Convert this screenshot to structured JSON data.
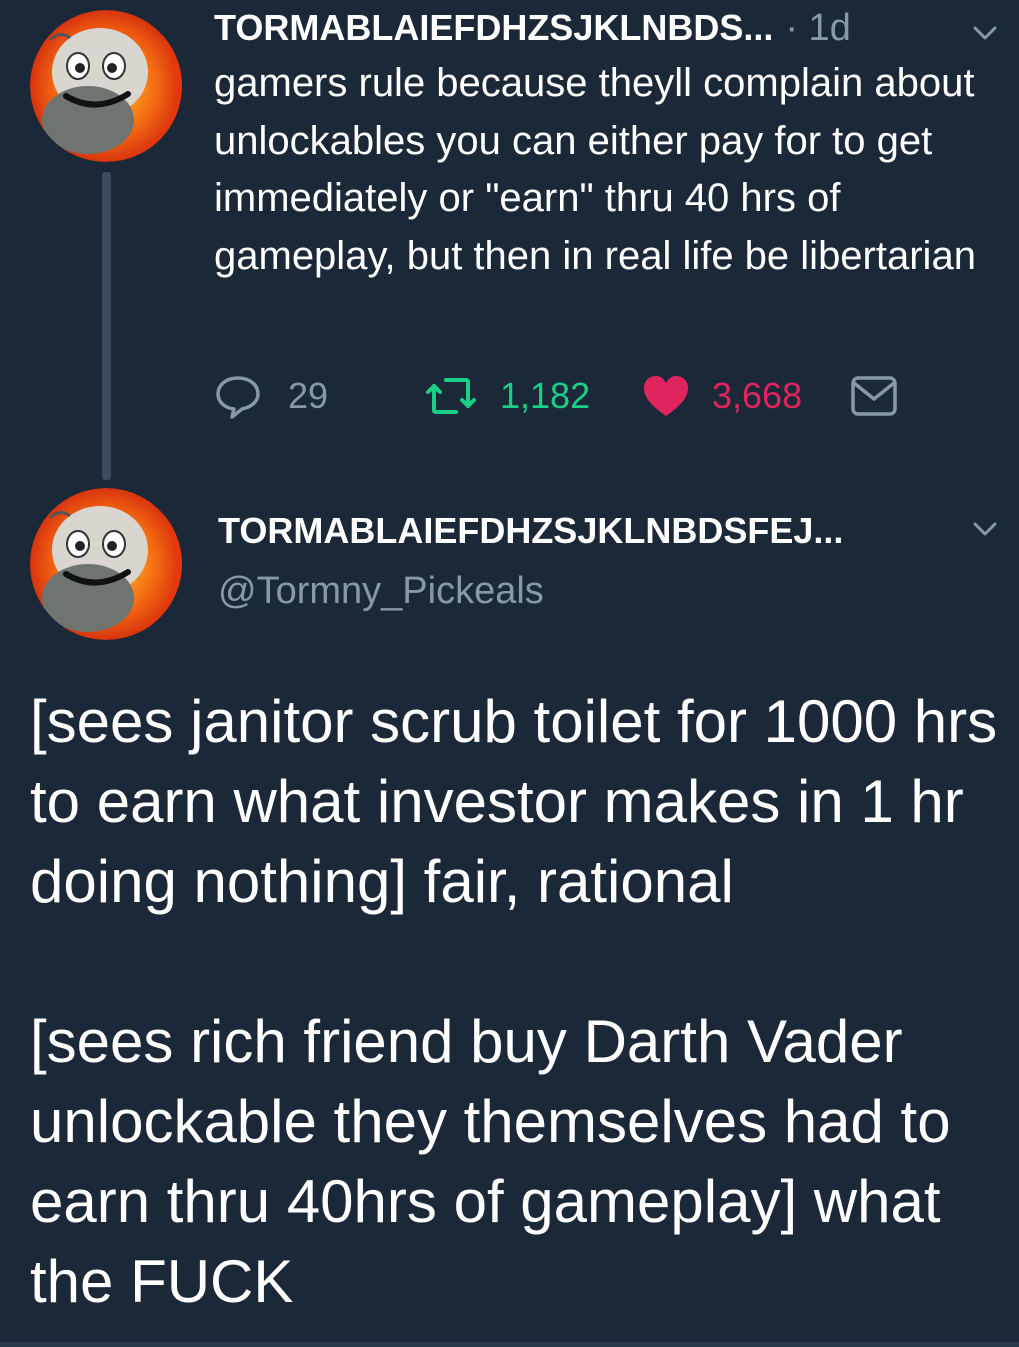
{
  "colors": {
    "background": "#1b2838",
    "text": "#ffffff",
    "muted": "#8899a6",
    "retweet": "#19cf86",
    "like": "#e0245e",
    "thread_line": "#3c4b5b"
  },
  "tweet1": {
    "display_name": "TORMABLAIEFDHZSJKLNBDS...",
    "time": "· 1d",
    "text": "gamers rule because theyll complain about unlockables you can either pay for to get immediately or \"earn\" thru 40 hrs of gameplay, but then in real life be libertarian",
    "actions": {
      "replies": "29",
      "retweets": "1,182",
      "likes": "3,668"
    },
    "icons": [
      "avatar",
      "chevron-down-icon",
      "reply-icon",
      "retweet-icon",
      "heart-icon",
      "message-icon"
    ]
  },
  "tweet2": {
    "display_name": "TORMABLAIEFDHZSJKLNBDSFEJ...",
    "handle": "@Tormny_Pickeals",
    "paragraphs": [
      "[sees janitor scrub toilet for 1000 hrs to earn what investor makes in 1 hr doing nothing] fair, rational",
      "[sees rich friend buy Darth Vader unlockable they themselves had to earn thru 40hrs of gameplay] what the FUCK"
    ],
    "icons": [
      "avatar",
      "chevron-down-icon"
    ]
  }
}
